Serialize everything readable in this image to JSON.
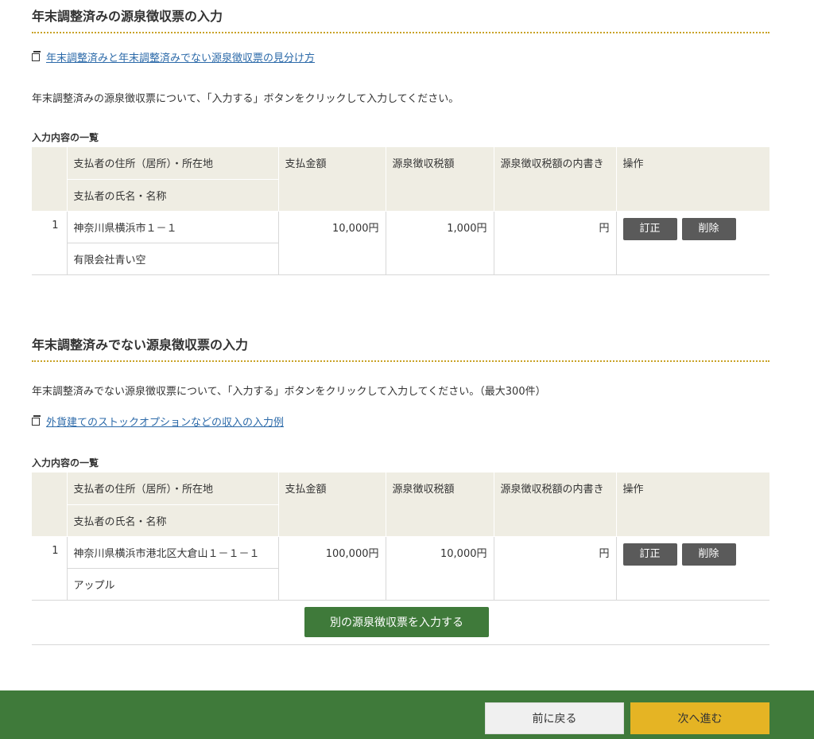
{
  "section1": {
    "title": "年末調整済みの源泉徴収票の入力",
    "link": "年末調整済みと年末調整済みでない源泉徴収票の見分け方",
    "description": "年末調整済みの源泉徴収票について、「入力する」ボタンをクリックして入力してください。",
    "list_caption": "入力内容の一覧",
    "rows": [
      {
        "no": "1",
        "address": "神奈川県横浜市１－１",
        "name": "有限会社青い空",
        "amount": "10,000円",
        "tax": "1,000円",
        "inner": "円"
      }
    ]
  },
  "section2": {
    "title": "年末調整済みでない源泉徴収票の入力",
    "description": "年末調整済みでない源泉徴収票について、「入力する」ボタンをクリックして入力してください。（最大300件）",
    "link": "外貨建てのストックオプションなどの収入の入力例",
    "list_caption": "入力内容の一覧",
    "rows": [
      {
        "no": "1",
        "address": "神奈川県横浜市港北区大倉山１－１－１",
        "name": "アップル",
        "amount": "100,000円",
        "tax": "10,000円",
        "inner": "円"
      }
    ],
    "add_button": "別の源泉徴収票を入力する"
  },
  "table_headers": {
    "address": "支払者の住所（居所）・所在地",
    "name": "支払者の氏名・名称",
    "amount": "支払金額",
    "tax": "源泉徴収税額",
    "inner": "源泉徴収税額の内書き",
    "ops": "操作"
  },
  "actions": {
    "edit": "訂正",
    "delete": "削除"
  },
  "footer": {
    "back": "前に戻る",
    "next": "次へ進む"
  },
  "colors": {
    "accent_green": "#3f7a3a",
    "next_yellow": "#e5b424",
    "header_bg": "#efede3",
    "link_blue": "#2c6aa9",
    "dotted_gold": "#c9a227"
  }
}
